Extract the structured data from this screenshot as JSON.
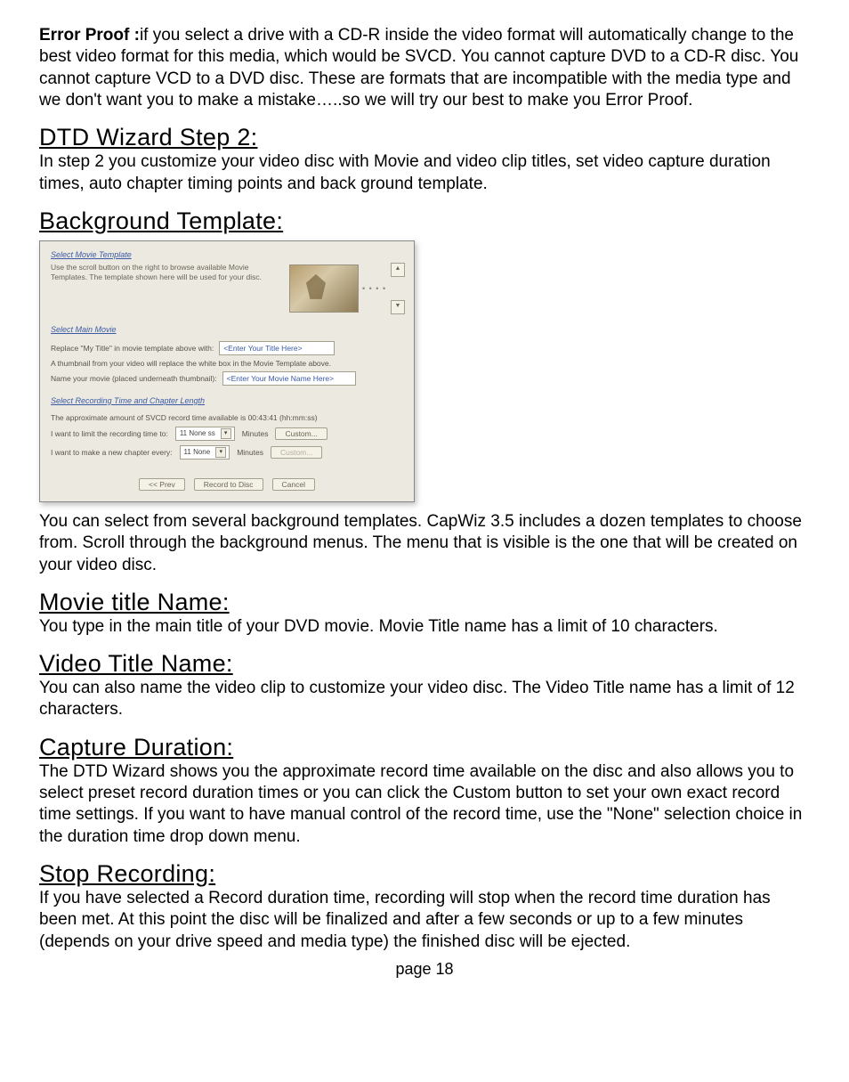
{
  "intro": {
    "lead_label": "Error Proof :",
    "lead_text": "if you select a drive with a CD-R inside the video format will automatically change to the best video format for this media, which would be SVCD. You cannot capture DVD to a CD-R disc. You cannot capture VCD to a DVD disc. These are formats that are incompatible with the media type and we don't want you to make a mistake…..so we will try our best to make you Error Proof."
  },
  "sections": {
    "step2_heading": "DTD Wizard Step 2:",
    "step2_body": "In step 2 you customize your video disc with Movie and video clip titles, set video capture duration times, auto chapter timing points and back ground template.",
    "bg_heading": "Background Template:",
    "bg_body": "You can select from several background templates. CapWiz 3.5  includes a dozen templates to choose from. Scroll through the background menus.  The menu that is visible is the one that will be created on your video disc.",
    "movie_heading": "Movie title Name:",
    "movie_body": "You type in the main title of your DVD movie. Movie Title name has a limit of 10 characters.",
    "video_heading": "Video Title Name:",
    "video_body": "You can also name the video clip to customize your video disc. The Video Title name has a limit of 12 characters.",
    "capture_heading": "Capture Duration:",
    "capture_body": "The DTD Wizard shows you the approximate record time available on the disc and also allows you to select preset record duration times or you can click the Custom button to set your own exact record time settings. If you want to have manual control of the record time, use the \"None\" selection choice in the duration time drop down menu.",
    "stop_heading": "Stop Recording:",
    "stop_body": "If you have selected a Record duration time, recording will stop when the record time duration has been met.  At this point the disc will be finalized and after a few seconds or up to a few minutes (depends on your drive speed and media type) the finished disc will be ejected."
  },
  "dialog": {
    "panel1_link": "Select Movie Template",
    "panel1_text": "Use the scroll button on the right to browse available Movie Templates. The template shown here will be used for your disc.",
    "panel2_link": "Select Main Movie",
    "panel2_line1_a": "Replace \"My Title\" in movie template above with:",
    "panel2_line1_input": "<Enter Your Title Here>",
    "panel2_line2": "A thumbnail from your video will replace the white box in the Movie Template above.",
    "panel2_line3_a": "Name your movie (placed underneath thumbnail):",
    "panel2_line3_input": "<Enter Your Movie Name Here>",
    "panel3_link": "Select Recording Time and Chapter Length",
    "panel3_avail": "The approximate amount of SVCD record time available is  00:43:41 (hh:mm:ss)",
    "row1_label": "I want to limit the recording time to:",
    "row1_combo": "11 None ss",
    "row_unit": "Minutes",
    "row_custom": "Custom...",
    "row2_label": "I want to make a new chapter every:",
    "row2_combo": "11 None",
    "btn_prev": "<< Prev",
    "btn_record": "Record to Disc",
    "btn_cancel": "Cancel"
  },
  "footer": "page 18"
}
